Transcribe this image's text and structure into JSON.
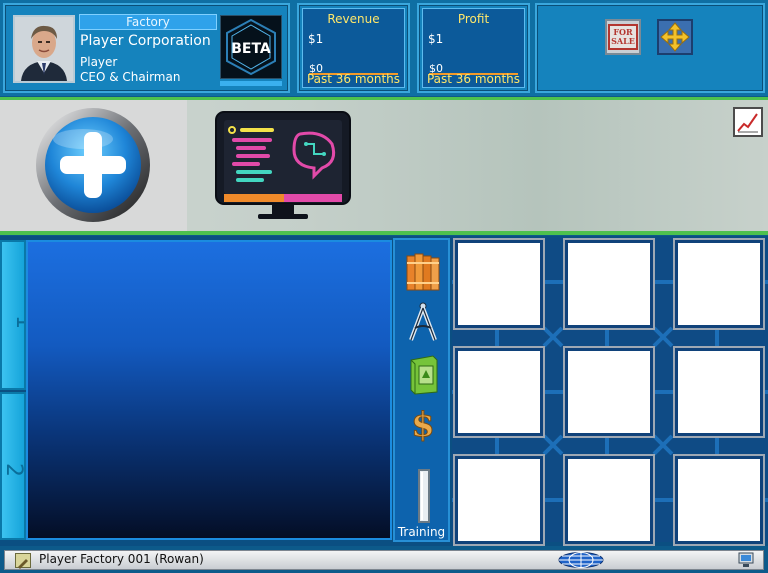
{
  "profile": {
    "factory_label": "Factory",
    "corporation": "Player Corporation",
    "player": "Player",
    "role": "CEO & Chairman",
    "logo_text": "BETA"
  },
  "revenue": {
    "title": "Revenue",
    "top_value": "$1",
    "bottom_value": "$0",
    "period": "Past 36 months"
  },
  "profit": {
    "title": "Profit",
    "top_value": "$1",
    "bottom_value": "$0",
    "period": "Past 36 months"
  },
  "actions": {
    "sale_text_1": "FOR",
    "sale_text_2": "SALE"
  },
  "tabs": [
    {
      "label": "1"
    },
    {
      "label": "2"
    }
  ],
  "tools": {
    "items": [
      {
        "icon": "books-icon"
      },
      {
        "icon": "compass-icon"
      },
      {
        "icon": "textbook-icon"
      },
      {
        "icon": "dollar-icon"
      },
      {
        "icon": "training-bar-icon"
      }
    ],
    "training_label": "Training"
  },
  "slots": {
    "rows": 3,
    "cols": 3
  },
  "status_bar": {
    "text": "Player Factory 001 (Rowan)"
  },
  "colors": {
    "accent_green": "#4ec14e",
    "panel_blue": "#1583bd",
    "title_yellow": "#ffe76a",
    "chart_line_orange": "#f39a2a"
  }
}
